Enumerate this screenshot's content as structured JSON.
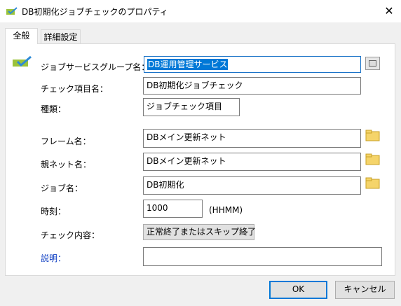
{
  "window": {
    "title": "DB初期化ジョブチェックのプロパティ",
    "close_symbol": "✕"
  },
  "tabs": [
    {
      "label": "全般",
      "active": true
    },
    {
      "label": "詳細設定",
      "active": false
    }
  ],
  "form": {
    "service_group": {
      "label": "ジョブサービスグループ名：",
      "value": "DB運用管理サービス"
    },
    "check_item": {
      "label": "チェック項目名：",
      "value": "DB初期化ジョブチェック"
    },
    "kind": {
      "label": "種類：",
      "value": "ジョブチェック項目"
    },
    "frame": {
      "label": "フレーム名：",
      "value": "DBメイン更新ネット"
    },
    "parent_net": {
      "label": "親ネット名：",
      "value": "DBメイン更新ネット"
    },
    "job": {
      "label": "ジョブ名：",
      "value": "DB初期化"
    },
    "time": {
      "label": "時刻：",
      "value": "1000",
      "unit": "(HHMM)"
    },
    "check_content": {
      "label": "チェック内容：",
      "value": "正常終了またはスキップ終了",
      "chevron": "⌵"
    },
    "description": {
      "label": "説明：",
      "value": ""
    }
  },
  "buttons": {
    "ok": "OK",
    "cancel": "キャンセル"
  },
  "colors": {
    "check_icon": "#2e8bd6",
    "check_icon_bg": "#9bc33a",
    "link_label": "#0f3fc3",
    "selection": "#0078d7"
  }
}
